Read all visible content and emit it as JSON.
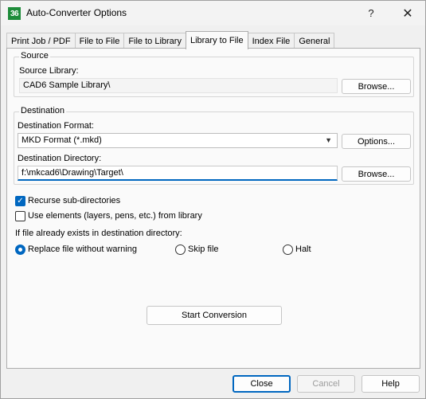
{
  "window": {
    "title": "Auto-Converter Options",
    "app_icon_text": "36",
    "help_symbol": "?",
    "close_symbol": "✕"
  },
  "tabs": [
    {
      "label": "Print Job / PDF"
    },
    {
      "label": "File to File"
    },
    {
      "label": "File to Library"
    },
    {
      "label": "Library to File"
    },
    {
      "label": "Index File"
    },
    {
      "label": "General"
    }
  ],
  "active_tab": "Library to File",
  "source": {
    "group_label": "Source",
    "library_label": "Source Library:",
    "library_value": "CAD6 Sample Library\\",
    "browse_label": "Browse..."
  },
  "destination": {
    "group_label": "Destination",
    "format_label": "Destination Format:",
    "format_value": "MKD Format (*.mkd)",
    "options_label": "Options...",
    "directory_label": "Destination Directory:",
    "directory_value": "f:\\mkcad6\\Drawing\\Target\\",
    "browse_label": "Browse..."
  },
  "options": {
    "recurse_label": "Recurse sub-directories",
    "recurse_checked": true,
    "use_elements_label": "Use elements (layers, pens, etc.) from library",
    "use_elements_checked": false,
    "exists_label": "If file already exists in destination directory:",
    "replace_label": "Replace file without warning",
    "skip_label": "Skip file",
    "halt_label": "Halt",
    "selected": "Replace file without warning"
  },
  "start_label": "Start Conversion",
  "footer": {
    "close_label": "Close",
    "cancel_label": "Cancel",
    "help_label": "Help"
  },
  "colors": {
    "accent": "#0067c0",
    "app_icon_bg": "#1e8c3a"
  }
}
